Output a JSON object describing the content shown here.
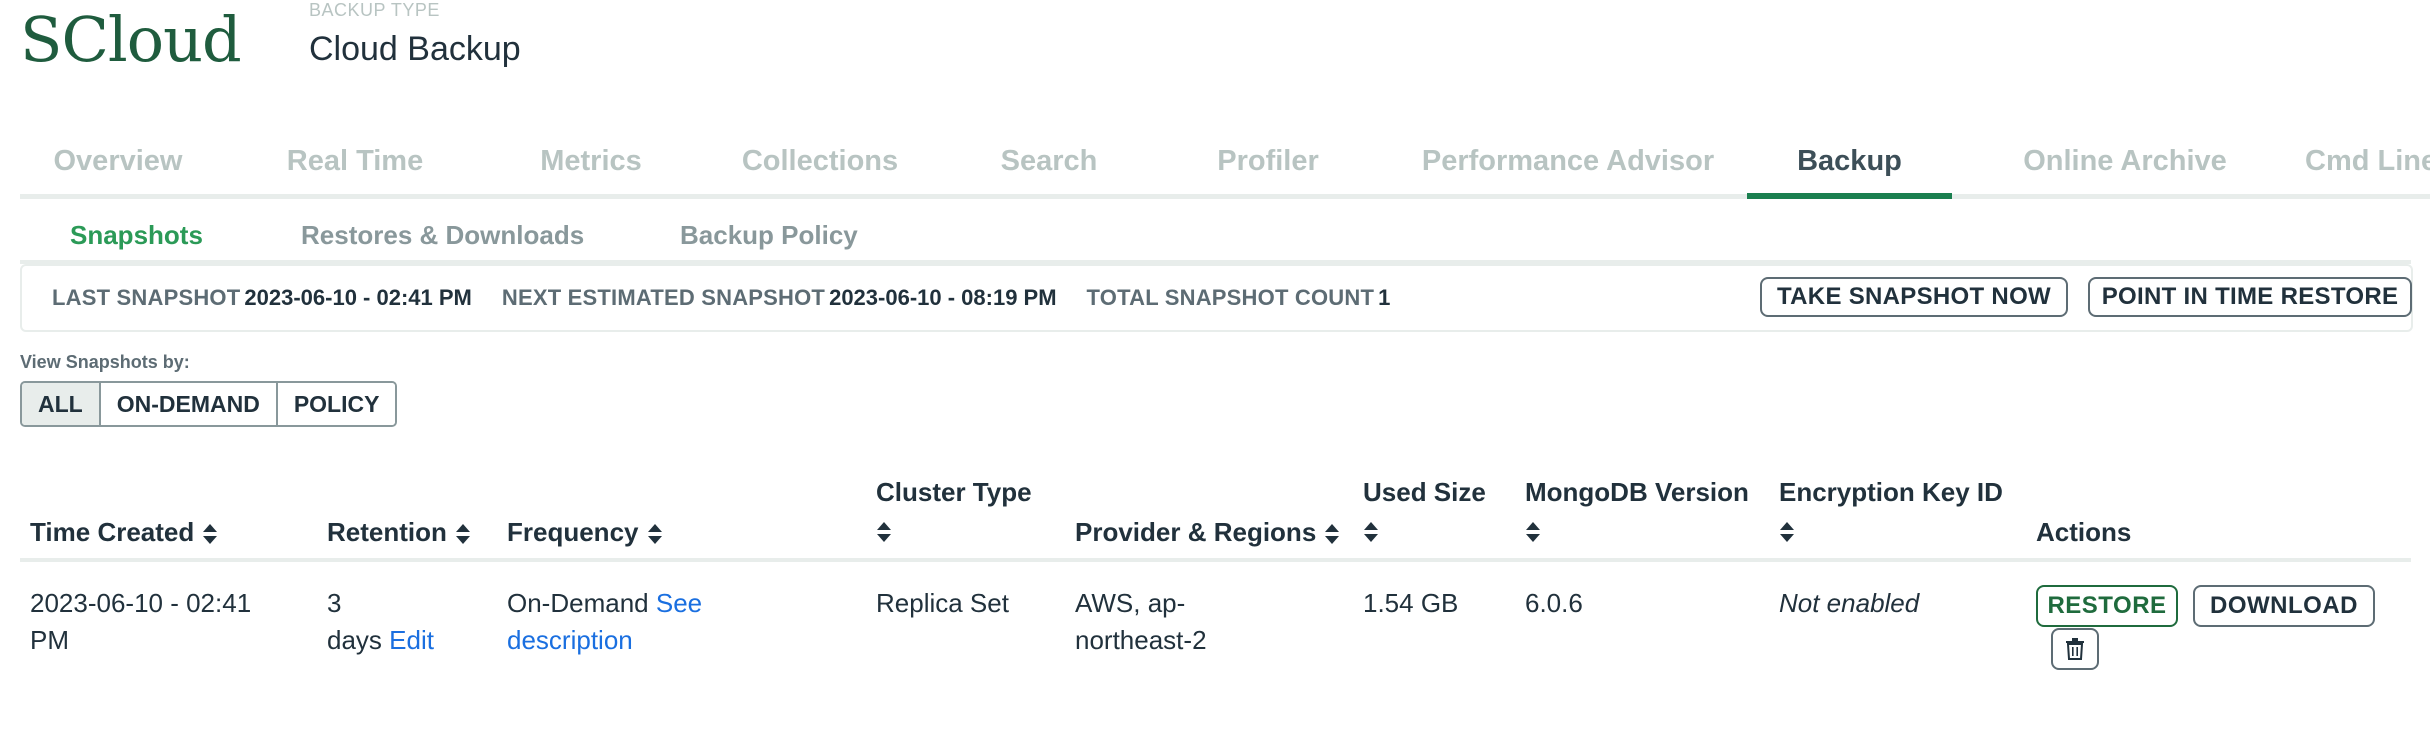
{
  "brand": {
    "logo": "SCloud"
  },
  "backup_type": {
    "label": "BACKUP TYPE",
    "value": "Cloud Backup"
  },
  "main_tabs": [
    {
      "label": "Overview"
    },
    {
      "label": "Real Time"
    },
    {
      "label": "Metrics"
    },
    {
      "label": "Collections"
    },
    {
      "label": "Search"
    },
    {
      "label": "Profiler"
    },
    {
      "label": "Performance Advisor"
    },
    {
      "label": "Backup",
      "active": true
    },
    {
      "label": "Online Archive"
    },
    {
      "label": "Cmd Line"
    }
  ],
  "sub_tabs": [
    {
      "label": "Snapshots",
      "active": true
    },
    {
      "label": "Restores & Downloads"
    },
    {
      "label": "Backup Policy"
    }
  ],
  "summary": {
    "last_label": "LAST SNAPSHOT",
    "last_value": "2023-06-10 - 02:41 PM",
    "next_label": "NEXT ESTIMATED SNAPSHOT",
    "next_value": "2023-06-10 - 08:19 PM",
    "count_label": "TOTAL SNAPSHOT COUNT",
    "count_value": "1",
    "take_snapshot": "TAKE SNAPSHOT NOW",
    "pit_restore": "POINT IN TIME RESTORE"
  },
  "view_by": {
    "label": "View Snapshots by:",
    "options": [
      "ALL",
      "ON-DEMAND",
      "POLICY"
    ],
    "selected": "ALL"
  },
  "table": {
    "columns": {
      "time_created": "Time Created",
      "retention": "Retention",
      "frequency": "Frequency",
      "cluster_type": "Cluster Type",
      "provider": "Provider & Regions",
      "used_size": "Used Size",
      "mongo_version": "MongoDB Version",
      "encryption": "Encryption Key ID",
      "actions": "Actions"
    },
    "rows": [
      {
        "time_created_1": "2023-06-10 - 02:41",
        "time_created_2": "PM",
        "retention_1": "3",
        "retention_2": "days",
        "retention_edit": "Edit",
        "frequency_1": "On-Demand",
        "frequency_link_1": "See",
        "frequency_link_2": "description",
        "cluster_type": "Replica Set",
        "provider_1": "AWS, ap-",
        "provider_2": "northeast-2",
        "used_size": "1.54 GB",
        "mongo_version": "6.0.6",
        "encryption": "Not enabled",
        "restore": "RESTORE",
        "download": "DOWNLOAD"
      }
    ]
  },
  "icons": {
    "sort": "sort-icon",
    "delete": "trash-icon"
  },
  "colors": {
    "brand_green": "#1f5c3e",
    "active_subtab": "#2b9a57",
    "link": "#1a6fe0",
    "active_tab_underline": "#1a7f4f"
  }
}
